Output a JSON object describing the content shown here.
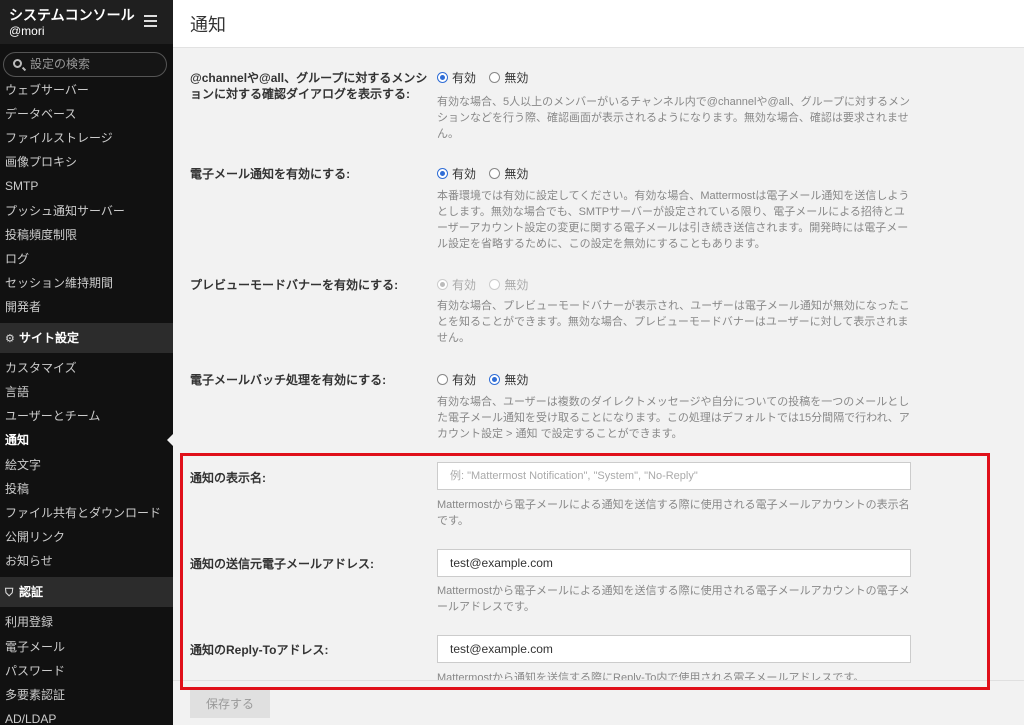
{
  "sidebar": {
    "title": "システムコンソール",
    "user": "@mori",
    "search_placeholder": "設定の検索",
    "items_top": [
      "ウェブサーバー",
      "データベース",
      "ファイルストレージ",
      "画像プロキシ",
      "SMTP",
      "プッシュ通知サーバー",
      "投稿頻度制限",
      "ログ",
      "セッション維持期間",
      "開発者"
    ],
    "section_site": "サイト設定",
    "items_site": [
      "カスタマイズ",
      "言語",
      "ユーザーとチーム",
      "通知",
      "絵文字",
      "投稿",
      "ファイル共有とダウンロード",
      "公開リンク",
      "お知らせ"
    ],
    "section_auth": "認証",
    "items_auth": [
      "利用登録",
      "電子メール",
      "パスワード",
      "多要素認証",
      "AD/LDAP"
    ]
  },
  "header": {
    "title": "通知"
  },
  "settings": {
    "confirm_dialog": {
      "label": "@channelや@all、グループに対するメンションに対する確認ダイアログを表示する:",
      "on": "有効",
      "off": "無効",
      "help": "有効な場合、5人以上のメンバーがいるチャンネル内で@channelや@all、グループに対するメンションなどを行う際、確認画面が表示されるようになります。無効な場合、確認は要求されません。"
    },
    "email_notify": {
      "label": "電子メール通知を有効にする:",
      "on": "有効",
      "off": "無効",
      "help": "本番環境では有効に設定してください。有効な場合、Mattermostは電子メール通知を送信しようとします。無効な場合でも、SMTPサーバーが設定されている限り、電子メールによる招待とユーザーアカウント設定の変更に関する電子メールは引き続き送信されます。開発時には電子メール設定を省略するために、この設定を無効にすることもあります。"
    },
    "preview_banner": {
      "label": "プレビューモードバナーを有効にする:",
      "on": "有効",
      "off": "無効",
      "help": "有効な場合、プレビューモードバナーが表示され、ユーザーは電子メール通知が無効になったことを知ることができます。無効な場合、プレビューモードバナーはユーザーに対して表示されません。"
    },
    "email_batch": {
      "label": "電子メールバッチ処理を有効にする:",
      "on": "有効",
      "off": "無効",
      "help": "有効な場合、ユーザーは複数のダイレクトメッセージや自分についての投稿を一つのメールとした電子メール通知を受け取ることになります。この処理はデフォルトでは15分間隔で行われ、アカウント設定 > 通知 で設定することができます。"
    },
    "display_name": {
      "label": "通知の表示名:",
      "placeholder": "例: \"Mattermost Notification\", \"System\", \"No-Reply\"",
      "help": "Mattermostから電子メールによる通知を送信する際に使用される電子メールアカウントの表示名です。"
    },
    "from_address": {
      "label": "通知の送信元電子メールアドレス:",
      "value": "test@example.com",
      "help": "Mattermostから電子メールによる通知を送信する際に使用される電子メールアカウントの電子メールアドレスです。"
    },
    "reply_to": {
      "label": "通知のReply-Toアドレス:",
      "value": "test@example.com",
      "help": "Mattermostから通知を送信する際にReply-To内で使用される電子メールアドレスです。"
    }
  },
  "save_label": "保存する",
  "colors": {
    "accent": "#2f6dd6",
    "highlight": "#e0101a"
  }
}
